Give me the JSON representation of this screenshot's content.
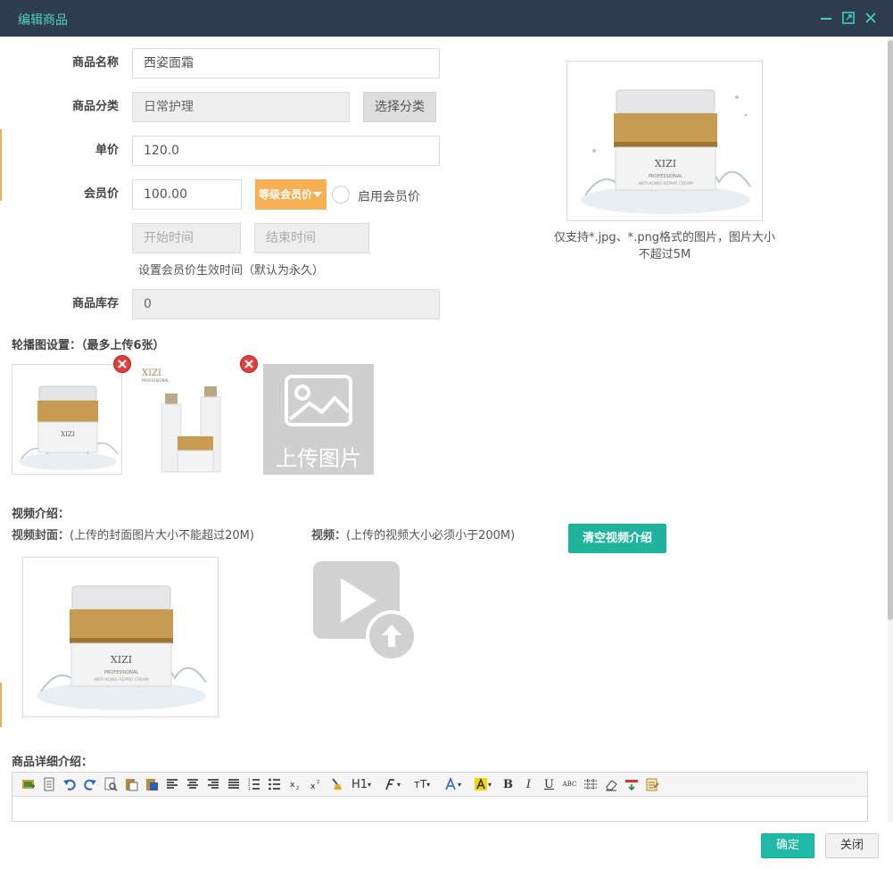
{
  "dialog": {
    "title": "编辑商品"
  },
  "form": {
    "name_label": "商品名称",
    "name_value": "西姿面霜",
    "category_label": "商品分类",
    "category_value": "日常护理",
    "category_button": "选择分类",
    "price_label": "单价",
    "price_value": "120.0",
    "member_price_label": "会员价",
    "member_price_value": "100.00",
    "member_level_button": "等级会员价",
    "enable_member_price": "启用会员价",
    "start_time_placeholder": "开始时间",
    "end_time_placeholder": "结束时间",
    "member_time_hint": "设置会员价生效时间（默认为永久）",
    "stock_label": "商品库存",
    "stock_value": "0"
  },
  "main_image": {
    "hint": "仅支持*.jpg、*.png格式的图片，图片大小不超过5M"
  },
  "carousel": {
    "label": "轮播图设置：（最多上传6张）",
    "upload_caption": "上传图片"
  },
  "video": {
    "section_label": "视频介绍：",
    "cover_label": "视频封面：",
    "cover_hint": "(上传的封面图片大小不能超过20M)",
    "video_label": "视频：",
    "video_hint": "(上传的视频大小必须小于200M)",
    "clear_button": "清空视频介绍"
  },
  "detail": {
    "label": "商品详细介绍：",
    "toolbar": {
      "h1": "H1",
      "tt": "тT",
      "bold": "B",
      "italic": "I",
      "underline": "U",
      "strike": "ABC"
    }
  },
  "product_brand": {
    "logo": "XIZI",
    "line1": "PROFESSIONAL",
    "line2": "ANTI-AGING REPAIR CREAM"
  },
  "footer": {
    "ok": "确定",
    "close": "关闭"
  },
  "colors": {
    "titlebar": "#2f3c4f",
    "accent_teal": "#1fb39d",
    "orange": "#f8b055"
  }
}
